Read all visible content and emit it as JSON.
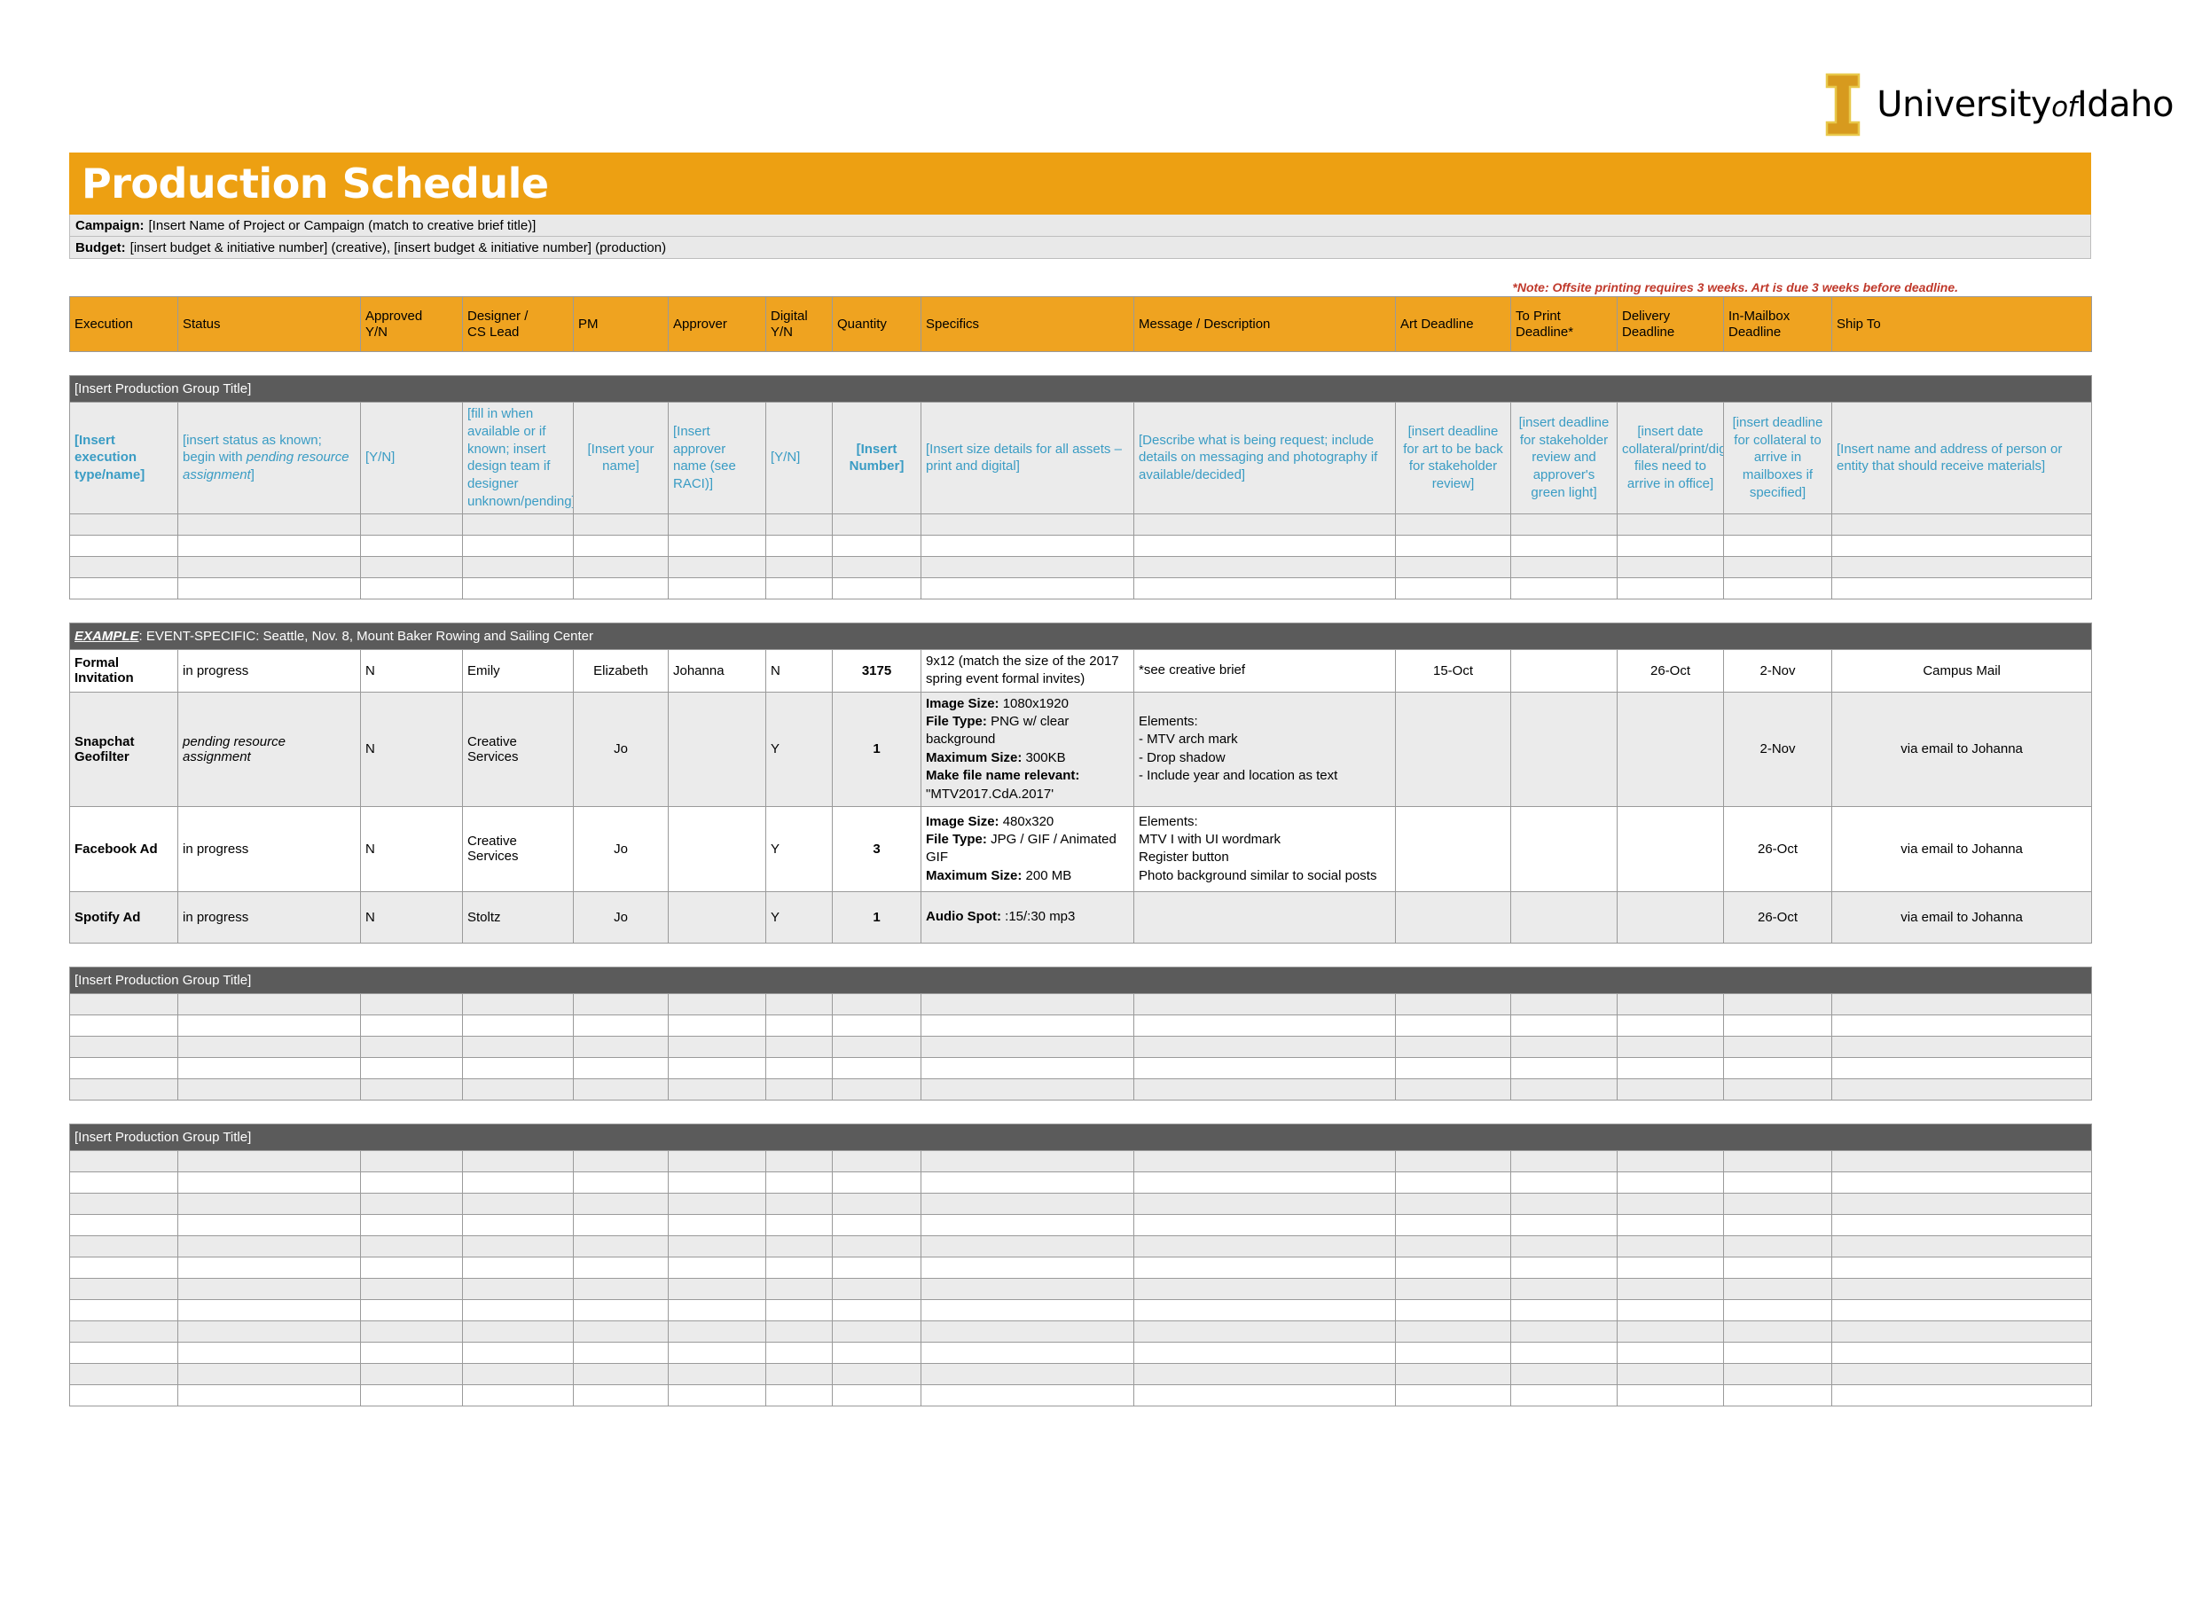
{
  "brand": {
    "logo_letter": "I",
    "logo_text_main": "University",
    "logo_text_of": "of",
    "logo_text_tail": "Idaho",
    "accent_orange": "#eda012",
    "header_orange": "#efa320",
    "group_gray": "#5b5b5b",
    "blue_text": "#3a9cc4",
    "note_red": "#c0392b"
  },
  "header": {
    "title": "Production Schedule",
    "campaign_label": "Campaign:",
    "campaign_value": "[Insert Name of Project or Campaign (match to creative brief title)]",
    "budget_label": "Budget:",
    "budget_value": "[insert budget & initiative number] (creative), [insert budget & initiative number] (production)",
    "note": "*Note: Offsite printing requires 3 weeks. Art is due 3 weeks before deadline."
  },
  "columns": [
    "Execution",
    "Status",
    "Approved Y/N",
    "Designer / CS Lead",
    "PM",
    "Approver",
    "Digital Y/N",
    "Quantity",
    "Specifics",
    "Message / Description",
    "Art Deadline",
    "To Print Deadline*",
    "Delivery Deadline",
    "In-Mailbox Deadline",
    "Ship To"
  ],
  "columns_split": [
    {
      "l1": "Execution",
      "l2": ""
    },
    {
      "l1": "Status",
      "l2": ""
    },
    {
      "l1": "Approved",
      "l2": "Y/N"
    },
    {
      "l1": "Designer /",
      "l2": "CS Lead"
    },
    {
      "l1": "PM",
      "l2": ""
    },
    {
      "l1": "Approver",
      "l2": ""
    },
    {
      "l1": "Digital",
      "l2": "Y/N"
    },
    {
      "l1": "Quantity",
      "l2": ""
    },
    {
      "l1": "Specifics",
      "l2": ""
    },
    {
      "l1": "Message / Description",
      "l2": ""
    },
    {
      "l1": "Art Deadline",
      "l2": ""
    },
    {
      "l1": "To Print",
      "l2": "Deadline*"
    },
    {
      "l1": "Delivery",
      "l2": "Deadline"
    },
    {
      "l1": "In-Mailbox",
      "l2": "Deadline"
    },
    {
      "l1": "Ship To",
      "l2": ""
    }
  ],
  "group1": {
    "title": "[Insert Production Group Title]",
    "instruction_row": {
      "execution": "[Insert execution type/name]",
      "status_pre": "[insert status as known; begin with ",
      "status_em": "pending resource assignment",
      "status_post": "]",
      "approved": "[Y/N]",
      "designer": "[fill in when available or if known; insert design team if designer unknown/pending]",
      "pm": "[Insert your name]",
      "approver": "[Insert approver name (see RACI)]",
      "digital": "[Y/N]",
      "quantity": "[Insert Number]",
      "specifics": "[Insert size details for all assets – print and digital]",
      "message": "[Describe what is being request; include details on messaging and photography if available/decided]",
      "art_deadline": "[insert deadline for art to be back for stakeholder review]",
      "to_print": "[insert deadline for stakeholder review and approver's green light]",
      "delivery": "[insert date collateral/print/digital files need to arrive in office]",
      "in_mailbox": "[insert deadline for collateral to arrive in mailboxes if specified]",
      "ship_to": "[Insert name and address of person or entity that should receive materials]"
    },
    "blank_rows": 4
  },
  "example_group": {
    "title_em": "EXAMPLE",
    "title_rest": ": EVENT-SPECIFIC: Seattle, Nov. 8, Mount Baker Rowing and Sailing Center",
    "rows": [
      {
        "execution": "Formal Invitation",
        "status": "in progress",
        "status_italic": false,
        "approved": "N",
        "designer": "Emily",
        "pm": "Elizabeth",
        "approver": "Johanna",
        "digital": "N",
        "quantity": "3175",
        "specifics_lines": [
          {
            "label": "",
            "value": "9x12 (match the size of the 2017 spring event formal invites)"
          }
        ],
        "message_lines": [
          "*see creative brief"
        ],
        "art_deadline": "15-Oct",
        "to_print": "",
        "delivery": "26-Oct",
        "in_mailbox": "2-Nov",
        "ship_to": "Campus Mail",
        "shaded": false,
        "height": 46
      },
      {
        "execution": "Snapchat Geofilter",
        "status": "pending resource assignment",
        "status_italic": true,
        "approved": "N",
        "designer": "Creative Services",
        "pm": "Jo",
        "approver": "",
        "digital": "Y",
        "quantity": "1",
        "specifics_lines": [
          {
            "label": "Image Size:",
            "value": " 1080x1920"
          },
          {
            "label": "File Type:",
            "value": "  PNG w/ clear background"
          },
          {
            "label": "Maximum Size:",
            "value": "  300KB"
          },
          {
            "label": "Make file name relevant:",
            "value": ""
          },
          {
            "label": "",
            "value": "\"MTV2017.CdA.2017'"
          }
        ],
        "message_lines": [
          "Elements:",
          "- MTV arch mark",
          "- Drop shadow",
          "- Include year and location as text"
        ],
        "art_deadline": "",
        "to_print": "",
        "delivery": "",
        "in_mailbox": "2-Nov",
        "ship_to": "via email to Johanna",
        "shaded": true,
        "height": 124
      },
      {
        "execution": "Facebook Ad",
        "status": "in progress",
        "status_italic": false,
        "approved": "N",
        "designer": "Creative Services",
        "pm": "Jo",
        "approver": "",
        "digital": "Y",
        "quantity": "3",
        "specifics_lines": [
          {
            "label": "Image Size:",
            "value": " 480x320"
          },
          {
            "label": "File Type:",
            "value": " JPG / GIF / Animated GIF"
          },
          {
            "label": "Maximum Size:",
            "value": " 200 MB"
          }
        ],
        "message_lines": [
          "Elements:",
          "MTV I  with UI wordmark",
          "Register button",
          "Photo background similar to social posts"
        ],
        "art_deadline": "",
        "to_print": "",
        "delivery": "",
        "in_mailbox": "26-Oct",
        "ship_to": "via email to Johanna",
        "shaded": false,
        "height": 96
      },
      {
        "execution": "Spotify Ad",
        "status": "in progress",
        "status_italic": false,
        "approved": "N",
        "designer": "Stoltz",
        "pm": "Jo",
        "approver": "",
        "digital": "Y",
        "quantity": "1",
        "specifics_lines": [
          {
            "label": "Audio Spot:",
            "value": " :15/:30 mp3"
          }
        ],
        "message_lines": [],
        "art_deadline": "",
        "to_print": "",
        "delivery": "",
        "in_mailbox": "26-Oct",
        "ship_to": "via email to Johanna",
        "shaded": true,
        "height": 58
      }
    ]
  },
  "group2": {
    "title": "[Insert Production Group Title]",
    "blank_rows": 5
  },
  "group3": {
    "title": "[Insert Production Group Title]",
    "blank_rows": 12
  }
}
